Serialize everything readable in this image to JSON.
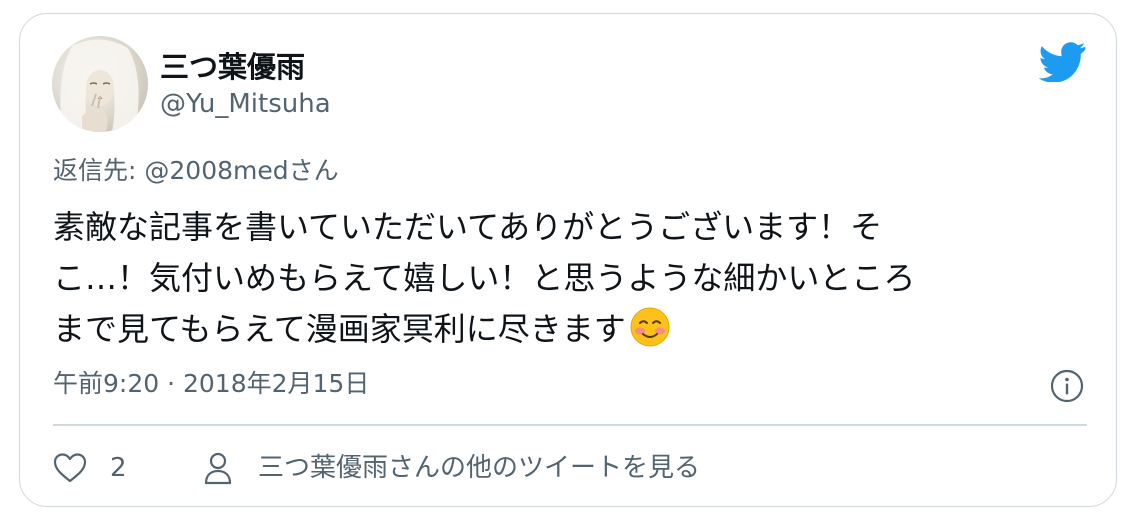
{
  "author": {
    "display_name": "三つ葉優雨",
    "handle": "@Yu_Mitsuha"
  },
  "reply": {
    "label": "返信先:",
    "to": "@2008medさん"
  },
  "tweet": {
    "lines": [
      "素敵な記事を書いていただいてありがとうございます！そ",
      "こ…！気付いめもらえて嬉しい！と思うような細かいところ",
      "まで見てもらえて漫画家冥利に尽きます"
    ],
    "emoji": "smiling-face-with-blush"
  },
  "timestamp": "午前9:20 · 2018年2月15日",
  "actions": {
    "like_count": "2",
    "more_tweets_link": "三つ葉優雨さんの他のツイートを見る"
  },
  "colors": {
    "twitter_blue": "#1d9bf0",
    "secondary_text": "#536471",
    "border": "#cfd9de"
  }
}
